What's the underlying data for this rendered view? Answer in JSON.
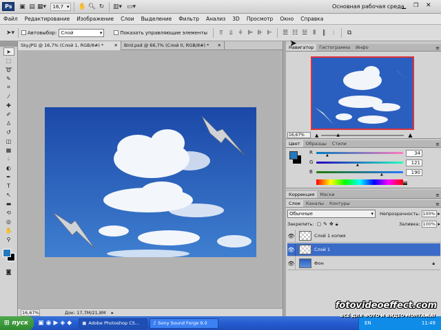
{
  "appbar": {
    "logo": "Ps",
    "zoom": "16,7",
    "workspace": "Основная рабочая среда"
  },
  "menu": [
    "Файл",
    "Редактирование",
    "Изображение",
    "Слои",
    "Выделение",
    "Фильтр",
    "Анализ",
    "3D",
    "Просмотр",
    "Окно",
    "Справка"
  ],
  "options": {
    "autoselect_label": "Автовыбор:",
    "autoselect_value": "Слой",
    "show_controls_label": "Показать управляющие элементы"
  },
  "document": {
    "tabs": [
      {
        "label": "Sky.JPG @ 16,7% (Слой 1, RGB/8#) *"
      },
      {
        "label": "Bird.psd @ 66,7% (Слой 0, RGB/8#) *"
      }
    ],
    "status_zoom": "16,67%",
    "status_doc": "Док: 17,7М/21,8М"
  },
  "navigator": {
    "tabs": [
      "Навигатор",
      "Гистограмма",
      "Инфо"
    ],
    "zoom": "16,67%"
  },
  "color": {
    "tabs": [
      "Цвет",
      "Образцы",
      "Стили"
    ],
    "r_label": "R",
    "r_value": "34",
    "g_label": "G",
    "g_value": "121",
    "b_label": "B",
    "b_value": "190",
    "foreground": "#2279be",
    "background": "#000000"
  },
  "adjust": {
    "tabs": [
      "Коррекция",
      "Маски"
    ]
  },
  "layers": {
    "tabs": [
      "Слои",
      "Каналы",
      "Контуры"
    ],
    "blend_mode": "Обычные",
    "opacity_label": "Непрозрачность:",
    "opacity_value": "100%",
    "lock_label": "Закрепить:",
    "fill_label": "Заливка:",
    "fill_value": "100%",
    "items": [
      {
        "name": "Слой 1 копия",
        "selected": false
      },
      {
        "name": "Слой 1",
        "selected": true
      },
      {
        "name": "Фон",
        "selected": false
      }
    ]
  },
  "taskbar": {
    "start": "пуск",
    "tasks": [
      "Adobe Photoshop CS...",
      "Sony Sound Forge 9.0"
    ],
    "lang": "EN",
    "time": "11:49"
  },
  "watermark": {
    "site": "fotovideoeffect.com",
    "tagline": "ВСЁ ДЛЯ ФОТО И ВИДЕО МОНТАЖА!"
  }
}
